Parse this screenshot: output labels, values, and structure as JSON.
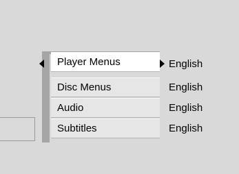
{
  "menu": {
    "items": [
      {
        "label": "Player Menus",
        "value": "English",
        "selected": true
      },
      {
        "label": "Disc Menus",
        "value": "English",
        "selected": false
      },
      {
        "label": "Audio",
        "value": "English",
        "selected": false
      },
      {
        "label": "Subtitles",
        "value": "English",
        "selected": false
      }
    ]
  },
  "colors": {
    "background": "#d9d9d9",
    "menu_item": "#e6e6e6",
    "menu_item_selected": "#ffffff",
    "menu_frame": "#a5a5a5",
    "text": "#000000"
  },
  "icons": {
    "left": "triangle-left-icon",
    "right": "triangle-right-icon"
  }
}
